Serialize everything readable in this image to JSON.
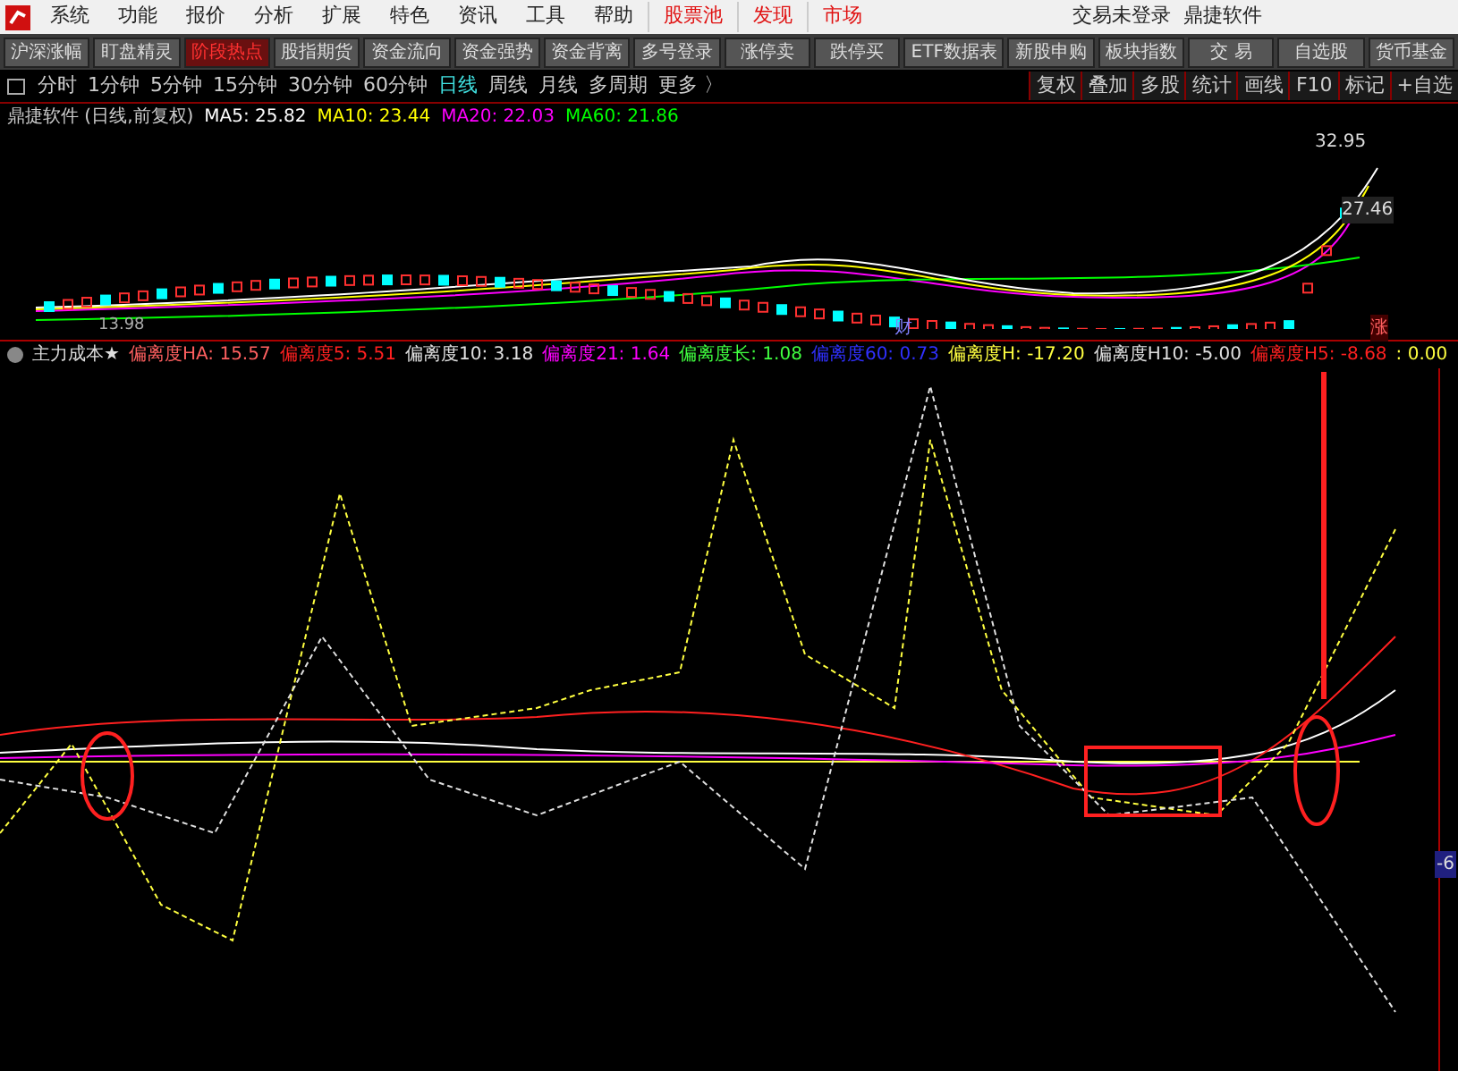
{
  "menu_bar": {
    "items": [
      {
        "label": "系统",
        "kind": "normal"
      },
      {
        "label": "功能",
        "kind": "normal"
      },
      {
        "label": "报价",
        "kind": "normal"
      },
      {
        "label": "分析",
        "kind": "normal"
      },
      {
        "label": "扩展",
        "kind": "normal"
      },
      {
        "label": "特色",
        "kind": "normal"
      },
      {
        "label": "资讯",
        "kind": "normal"
      },
      {
        "label": "工具",
        "kind": "normal"
      },
      {
        "label": "帮助",
        "kind": "normal"
      },
      {
        "label": "股票池",
        "kind": "highlight"
      },
      {
        "label": "发现",
        "kind": "highlight"
      },
      {
        "label": "市场",
        "kind": "highlight"
      }
    ],
    "status": "交易未登录  鼎捷软件"
  },
  "toolbar": [
    {
      "label": "沪深涨幅",
      "selected": false
    },
    {
      "label": "盯盘精灵",
      "selected": false
    },
    {
      "label": "阶段热点",
      "selected": true
    },
    {
      "label": "股指期货",
      "selected": false
    },
    {
      "label": "资金流向",
      "selected": false
    },
    {
      "label": "资金强势",
      "selected": false
    },
    {
      "label": "资金背离",
      "selected": false
    },
    {
      "label": "多号登录",
      "selected": false
    },
    {
      "label": "涨停卖",
      "selected": false
    },
    {
      "label": "跌停买",
      "selected": false
    },
    {
      "label": "ETF数据表",
      "selected": false
    },
    {
      "label": "新股申购",
      "selected": false
    },
    {
      "label": "板块指数",
      "selected": false
    },
    {
      "label": "交 易",
      "selected": false
    },
    {
      "label": "自选股",
      "selected": false
    },
    {
      "label": "货币基金",
      "selected": false
    }
  ],
  "periods": [
    {
      "label": "分时",
      "selected": false
    },
    {
      "label": "1分钟",
      "selected": false
    },
    {
      "label": "5分钟",
      "selected": false
    },
    {
      "label": "15分钟",
      "selected": false
    },
    {
      "label": "30分钟",
      "selected": false
    },
    {
      "label": "60分钟",
      "selected": false
    },
    {
      "label": "日线",
      "selected": true
    },
    {
      "label": "周线",
      "selected": false
    },
    {
      "label": "月线",
      "selected": false
    },
    {
      "label": "多周期",
      "selected": false
    },
    {
      "label": "更多 〉",
      "selected": false
    }
  ],
  "right_tools": [
    "复权",
    "叠加",
    "多股",
    "统计",
    "画线",
    "F10",
    "标记",
    "+自选"
  ],
  "price_chart": {
    "title": "鼎捷软件 (日线,前复权)",
    "ma": [
      {
        "label": "MA5: 25.82",
        "color": "#ffffff"
      },
      {
        "label": "MA10: 23.44",
        "color": "#ffff00"
      },
      {
        "label": "MA20: 22.03",
        "color": "#ff00ff"
      },
      {
        "label": "MA60: 21.86",
        "color": "#00ff00"
      }
    ],
    "high": "32.95",
    "last": "27.46",
    "low": "13.98",
    "marker_1": "财",
    "marker_2": "涨"
  },
  "indicator": {
    "name": "主力成本★",
    "values": [
      {
        "label": "偏离度HA: 15.57",
        "color": "#ff6060"
      },
      {
        "label": "偏离度5: 5.51",
        "color": "#ff2020"
      },
      {
        "label": "偏离度10: 3.18",
        "color": "#e0e0e0"
      },
      {
        "label": "偏离度21: 1.64",
        "color": "#ff00ff"
      },
      {
        "label": "偏离度长: 1.08",
        "color": "#40ff40"
      },
      {
        "label": "偏离度60: 0.73",
        "color": "#3030ff"
      },
      {
        "label": "偏离度H: -17.20",
        "color": "#ffff40"
      },
      {
        "label": "偏离度H10: -5.00",
        "color": "#e0e0e0"
      },
      {
        "label": "偏离度H5: -8.68",
        "color": "#ff2020"
      },
      {
        "label": ": 0.00",
        "color": "#ffff40"
      }
    ],
    "axis_label": "-6"
  }
}
